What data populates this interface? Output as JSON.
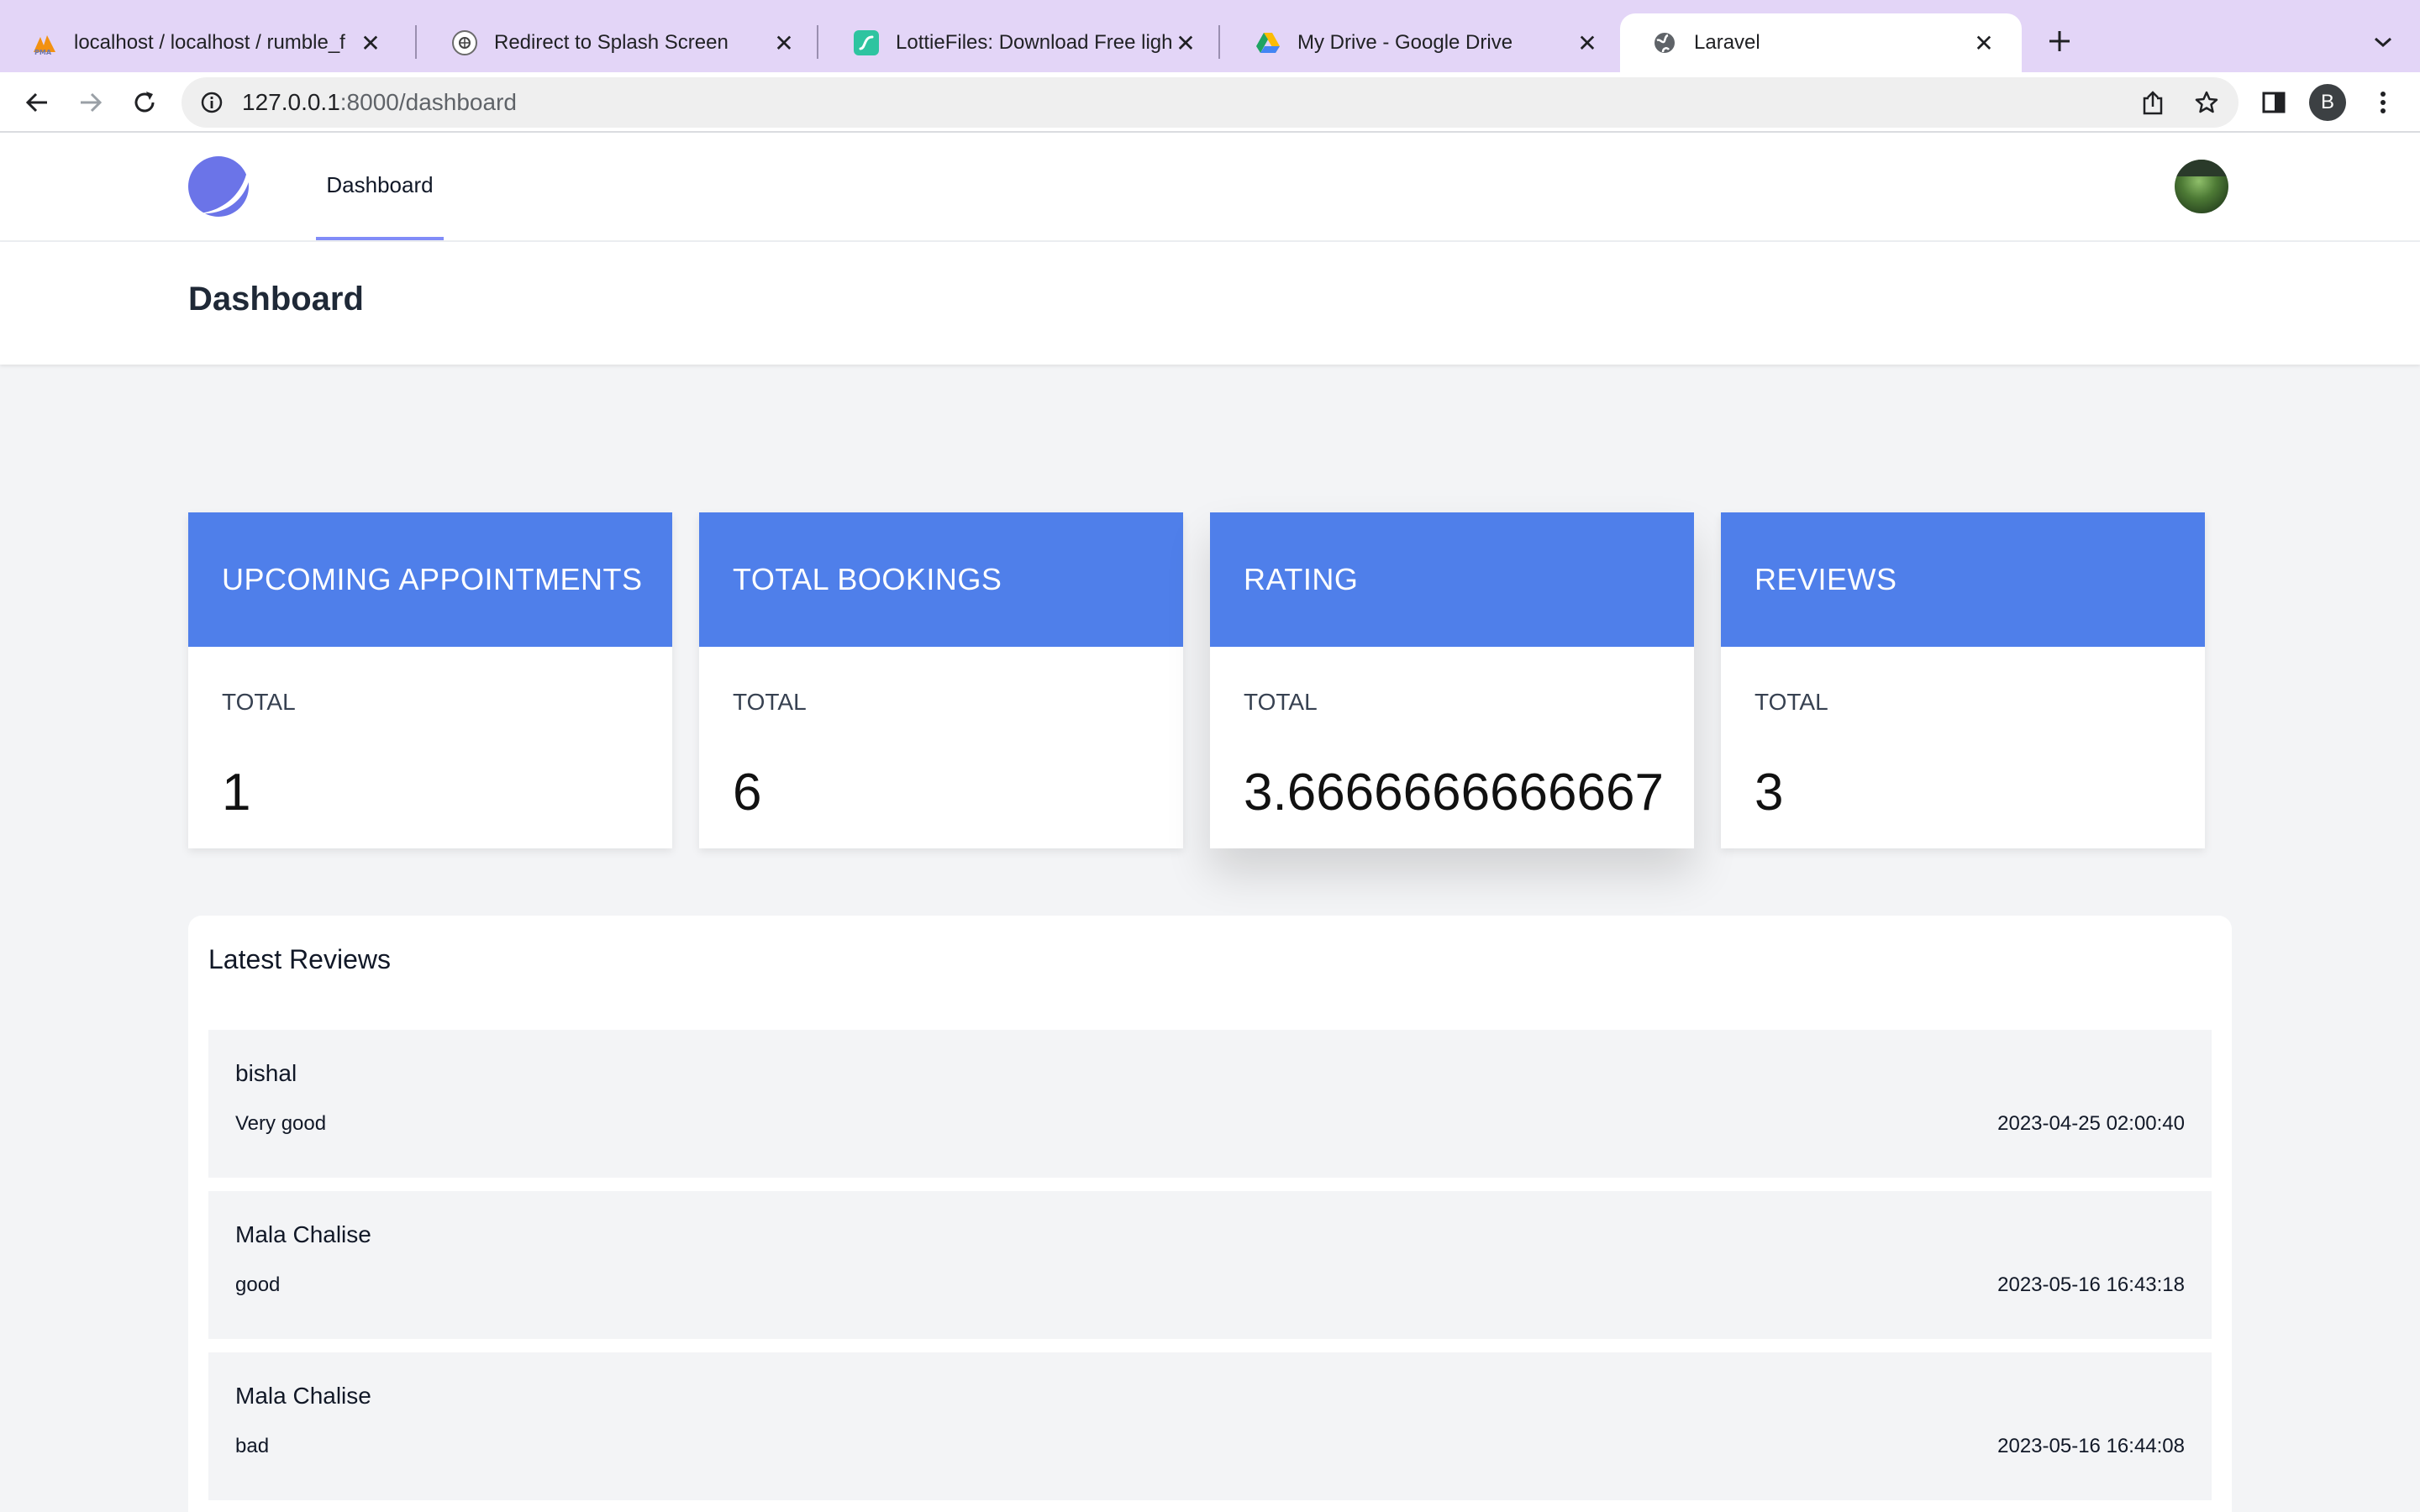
{
  "browser": {
    "tabs": [
      {
        "title": "localhost / localhost / rumble_f",
        "favicon": "pma-icon"
      },
      {
        "title": "Redirect to Splash Screen",
        "favicon": "openai-icon"
      },
      {
        "title": "LottieFiles: Download Free ligh",
        "favicon": "lottie-icon"
      },
      {
        "title": "My Drive - Google Drive",
        "favicon": "google-drive-icon"
      },
      {
        "title": "Laravel",
        "favicon": "globe-icon",
        "active": true
      }
    ],
    "url_host": "127.0.0.1",
    "url_rest": ":8000/dashboard",
    "profile_initial": "B"
  },
  "nav": {
    "dashboard_link": "Dashboard"
  },
  "page": {
    "title": "Dashboard"
  },
  "cards": [
    {
      "title": "UPCOMING APPOINTMENTS",
      "label": "TOTAL",
      "value": "1"
    },
    {
      "title": "TOTAL BOOKINGS",
      "label": "TOTAL",
      "value": "6"
    },
    {
      "title": "RATING",
      "label": "TOTAL",
      "value": "3.6666666666667"
    },
    {
      "title": "REVIEWS",
      "label": "TOTAL",
      "value": "3"
    }
  ],
  "reviews": {
    "title": "Latest Reviews",
    "items": [
      {
        "name": "bishal",
        "text": "Very good",
        "date": "2023-04-25 02:00:40"
      },
      {
        "name": "Mala Chalise",
        "text": "good",
        "date": "2023-05-16 16:43:18"
      },
      {
        "name": "Mala Chalise",
        "text": "bad",
        "date": "2023-05-16 16:44:08"
      }
    ]
  },
  "colors": {
    "tabbar": "#e3d5f7",
    "card_header": "#4f7fea",
    "nav_underline": "#818cf8",
    "page_bg": "#f3f4f6"
  }
}
